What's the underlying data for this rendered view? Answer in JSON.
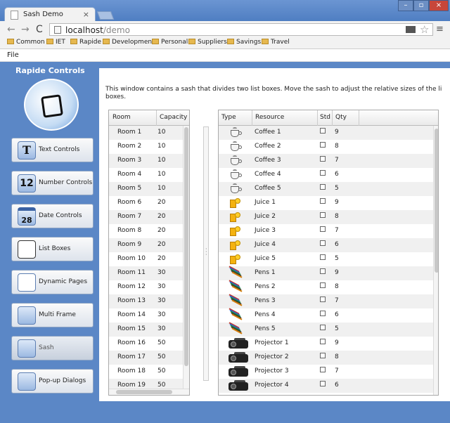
{
  "browser": {
    "tab_title": "Sash Demo",
    "tab_close": "×",
    "url_host": "localhost",
    "url_path": "/demo",
    "window_controls": {
      "min": "–",
      "max": "▫",
      "close": "×"
    },
    "nav": {
      "back": "←",
      "forward": "→",
      "reload": "C",
      "menu": "≡",
      "star": "☆"
    },
    "bookmarks": [
      "Common",
      "IET",
      "Rapide",
      "Development",
      "Personal",
      "Suppliers",
      "Savings",
      "Travel"
    ]
  },
  "menubar": {
    "file": "File"
  },
  "sidebar": {
    "title": "Rapide Controls",
    "items": [
      {
        "label": "Text Controls",
        "icon": "T"
      },
      {
        "label": "Number Controls",
        "icon": "12"
      },
      {
        "label": "Date Controls",
        "icon": "28"
      },
      {
        "label": "List Boxes",
        "icon": ""
      },
      {
        "label": "Dynamic Pages",
        "icon": ""
      },
      {
        "label": "Multi Frame",
        "icon": ""
      },
      {
        "label": "Sash",
        "icon": ""
      },
      {
        "label": "Pop-up Dialogs",
        "icon": ""
      }
    ]
  },
  "main": {
    "description": "This window contains a sash that divides two list boxes. Move the sash to adjust the relative sizes of the li",
    "description_line2": "boxes.",
    "rooms": {
      "headers": {
        "room": "Room",
        "capacity": "Capacity"
      },
      "rows": [
        {
          "room": "Room 1",
          "capacity": "10"
        },
        {
          "room": "Room 2",
          "capacity": "10"
        },
        {
          "room": "Room 3",
          "capacity": "10"
        },
        {
          "room": "Room 4",
          "capacity": "10"
        },
        {
          "room": "Room 5",
          "capacity": "10"
        },
        {
          "room": "Room 6",
          "capacity": "20"
        },
        {
          "room": "Room 7",
          "capacity": "20"
        },
        {
          "room": "Room 8",
          "capacity": "20"
        },
        {
          "room": "Room 9",
          "capacity": "20"
        },
        {
          "room": "Room 10",
          "capacity": "20"
        },
        {
          "room": "Room 11",
          "capacity": "30"
        },
        {
          "room": "Room 12",
          "capacity": "30"
        },
        {
          "room": "Room 13",
          "capacity": "30"
        },
        {
          "room": "Room 14",
          "capacity": "30"
        },
        {
          "room": "Room 15",
          "capacity": "30"
        },
        {
          "room": "Room 16",
          "capacity": "50"
        },
        {
          "room": "Room 17",
          "capacity": "50"
        },
        {
          "room": "Room 18",
          "capacity": "50"
        },
        {
          "room": "Room 19",
          "capacity": "50"
        }
      ]
    },
    "resources": {
      "headers": {
        "type": "Type",
        "resource": "Resource",
        "std": "Std",
        "qty": "Qty"
      },
      "rows": [
        {
          "icon": "coffee",
          "resource": "Coffee 1",
          "std": false,
          "qty": "9"
        },
        {
          "icon": "coffee",
          "resource": "Coffee 2",
          "std": false,
          "qty": "8"
        },
        {
          "icon": "coffee",
          "resource": "Coffee 3",
          "std": false,
          "qty": "7"
        },
        {
          "icon": "coffee",
          "resource": "Coffee 4",
          "std": false,
          "qty": "6"
        },
        {
          "icon": "coffee",
          "resource": "Coffee 5",
          "std": false,
          "qty": "5"
        },
        {
          "icon": "juice",
          "resource": "Juice 1",
          "std": false,
          "qty": "9"
        },
        {
          "icon": "juice",
          "resource": "Juice 2",
          "std": false,
          "qty": "8"
        },
        {
          "icon": "juice",
          "resource": "Juice 3",
          "std": false,
          "qty": "7"
        },
        {
          "icon": "juice",
          "resource": "Juice 4",
          "std": false,
          "qty": "6"
        },
        {
          "icon": "juice",
          "resource": "Juice 5",
          "std": false,
          "qty": "5"
        },
        {
          "icon": "pens",
          "resource": "Pens 1",
          "std": false,
          "qty": "9"
        },
        {
          "icon": "pens",
          "resource": "Pens 2",
          "std": false,
          "qty": "8"
        },
        {
          "icon": "pens",
          "resource": "Pens 3",
          "std": false,
          "qty": "7"
        },
        {
          "icon": "pens",
          "resource": "Pens 4",
          "std": false,
          "qty": "6"
        },
        {
          "icon": "pens",
          "resource": "Pens 5",
          "std": false,
          "qty": "5"
        },
        {
          "icon": "projector",
          "resource": "Projector 1",
          "std": false,
          "qty": "9"
        },
        {
          "icon": "projector",
          "resource": "Projector 2",
          "std": false,
          "qty": "8"
        },
        {
          "icon": "projector",
          "resource": "Projector 3",
          "std": false,
          "qty": "7"
        },
        {
          "icon": "projector",
          "resource": "Projector 4",
          "std": false,
          "qty": "6"
        }
      ]
    }
  },
  "colors": {
    "app_bg": "#5b87c6",
    "panel_bg": "#ffffff",
    "row_alt": "#f0f0f0"
  }
}
